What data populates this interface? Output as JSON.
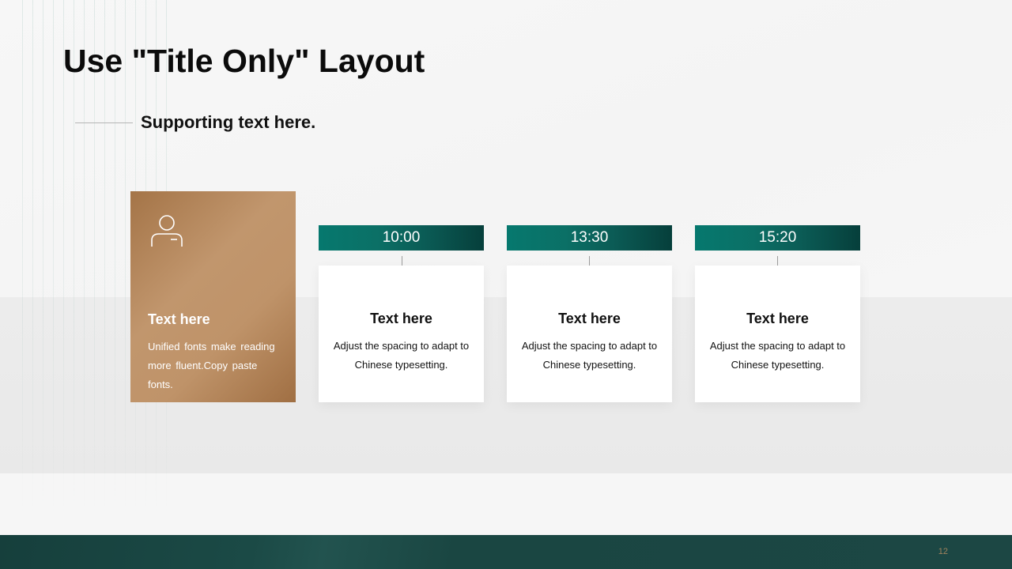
{
  "slide": {
    "title": "Use \"Title Only\" Layout",
    "subtitle": "Supporting text here.",
    "page_number": "12"
  },
  "feature": {
    "icon": "user-icon",
    "title": "Text here",
    "description": "Unified  fonts make reading more fluent.Copy paste fonts."
  },
  "timeline": [
    {
      "time": "10:00",
      "title": "Text here",
      "description": "Adjust the spacing to adapt to Chinese  typesetting."
    },
    {
      "time": "13:30",
      "title": "Text here",
      "description": "Adjust the spacing to adapt to Chinese  typesetting."
    },
    {
      "time": "15:20",
      "title": "Text here",
      "description": "Adjust the spacing to adapt to Chinese  typesetting."
    }
  ],
  "colors": {
    "accent_teal": "#0b7066",
    "accent_bronze": "#b88b60",
    "footer": "#1b4a46",
    "page_number": "#a2845e"
  }
}
